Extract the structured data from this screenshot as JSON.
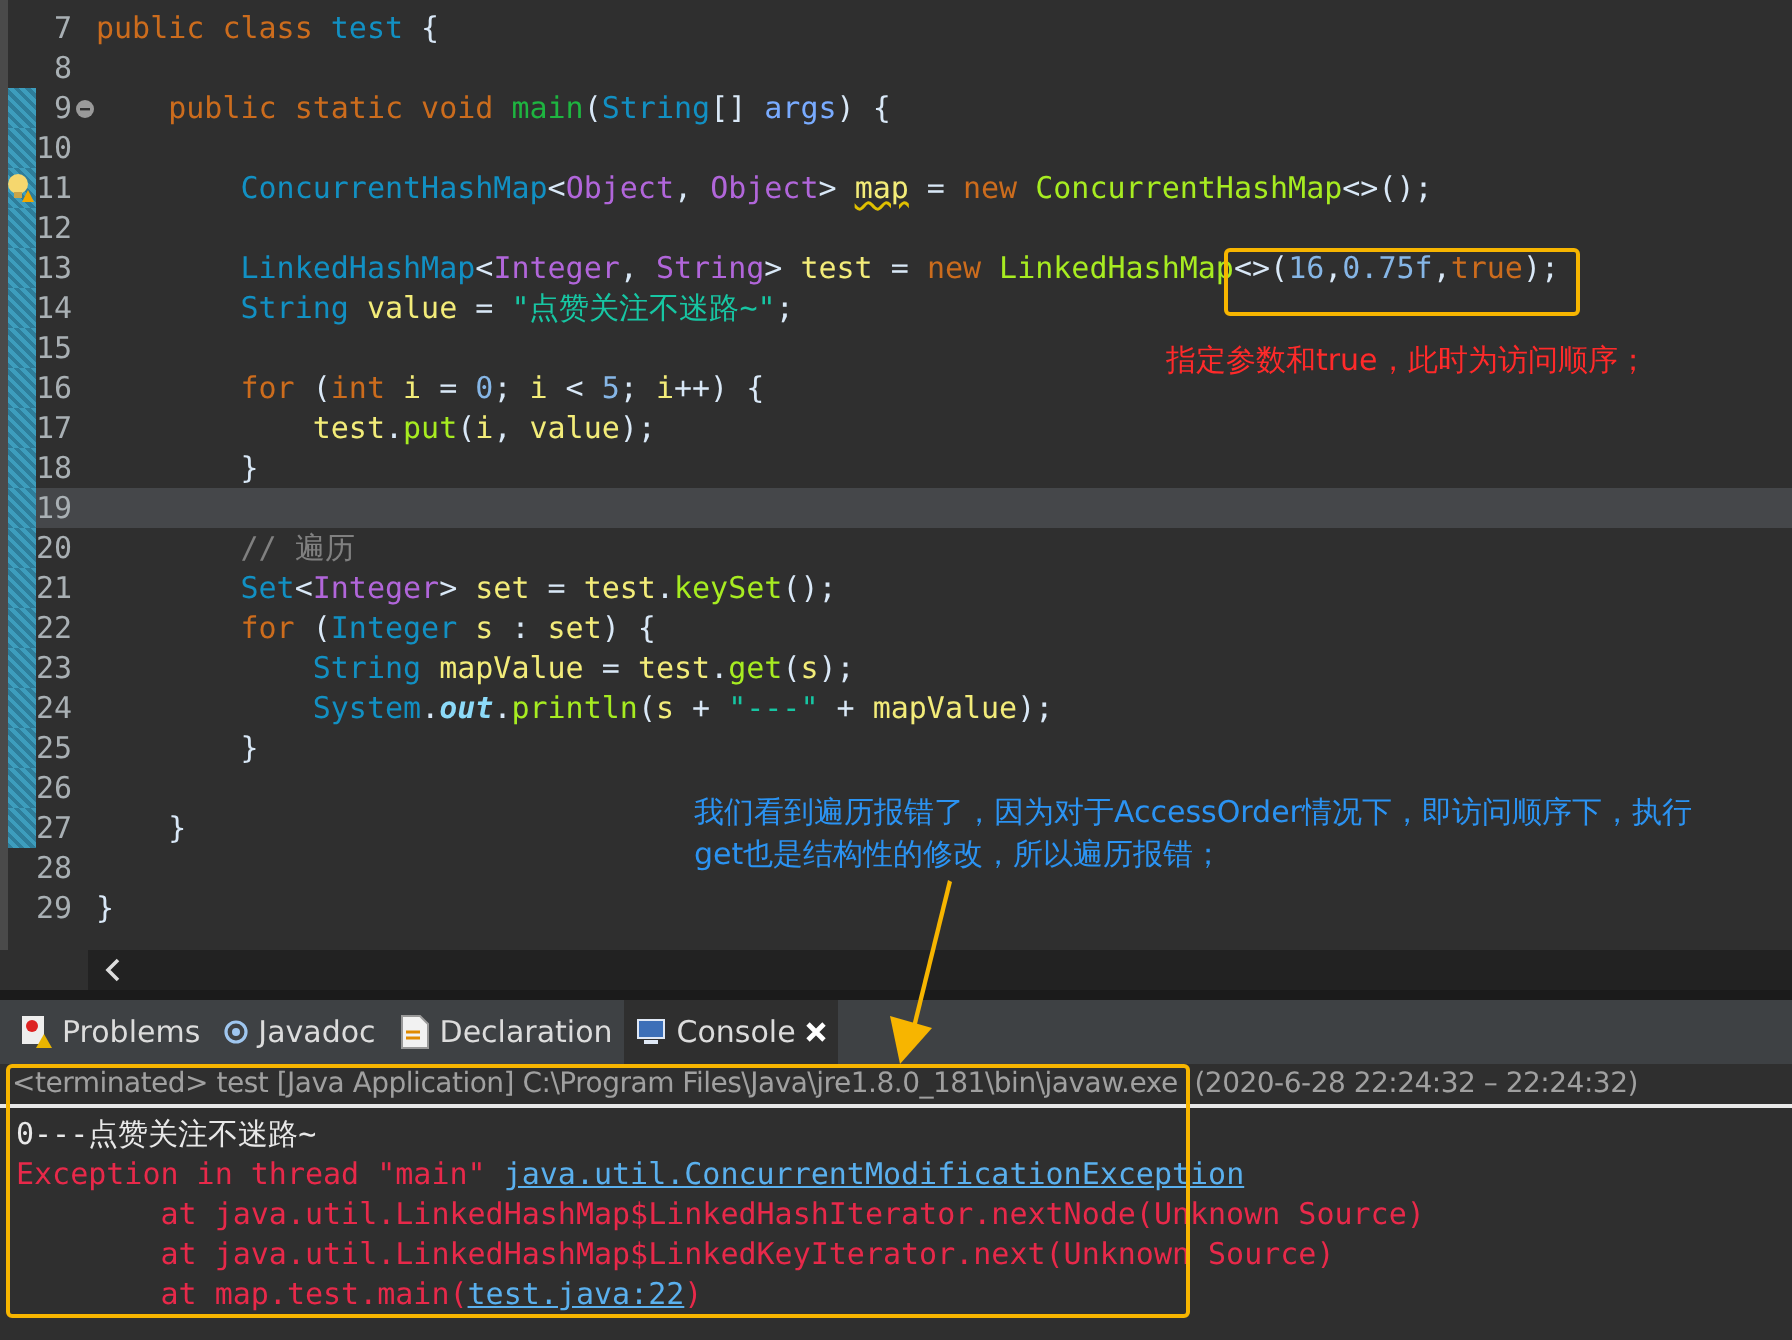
{
  "editor": {
    "lines": [
      {
        "number": "7",
        "changed": false,
        "current": false,
        "tokens": [
          {
            "text": "public class",
            "kind": "keyword"
          },
          {
            "text": " test",
            "kind": "type"
          },
          {
            "text": " {",
            "kind": "plain"
          }
        ]
      },
      {
        "number": "8",
        "changed": false,
        "current": false
      },
      {
        "number": "9",
        "changed": true,
        "current": false,
        "collapsible": true,
        "tokens": [
          {
            "text": "    public static void",
            "kind": "keyword"
          },
          {
            "text": " main",
            "kind": "method-decl"
          },
          {
            "text": "(",
            "kind": "plain"
          },
          {
            "text": "String",
            "kind": "type"
          },
          {
            "text": "[] ",
            "kind": "plain"
          },
          {
            "text": "args",
            "kind": "param"
          },
          {
            "text": ") {",
            "kind": "plain"
          }
        ]
      },
      {
        "number": "10",
        "changed": true,
        "current": false
      },
      {
        "number": "11",
        "changed": true,
        "current": false,
        "warning": true,
        "tokens": [
          {
            "text": "        ConcurrentHashMap",
            "kind": "type"
          },
          {
            "text": "<",
            "kind": "plain"
          },
          {
            "text": "Object",
            "kind": "type-param"
          },
          {
            "text": ", ",
            "kind": "plain"
          },
          {
            "text": "Object",
            "kind": "type-param"
          },
          {
            "text": "> ",
            "kind": "plain"
          },
          {
            "text": "map",
            "kind": "warn-var"
          },
          {
            "text": " = ",
            "kind": "plain"
          },
          {
            "text": "new",
            "kind": "keyword"
          },
          {
            "text": " ConcurrentHashMap",
            "kind": "method"
          },
          {
            "text": "<>();",
            "kind": "plain"
          }
        ]
      },
      {
        "number": "12",
        "changed": true,
        "current": false
      },
      {
        "number": "13",
        "changed": true,
        "current": false,
        "tokens": [
          {
            "text": "        LinkedHashMap",
            "kind": "type"
          },
          {
            "text": "<",
            "kind": "plain"
          },
          {
            "text": "Integer",
            "kind": "type-param"
          },
          {
            "text": ", ",
            "kind": "plain"
          },
          {
            "text": "String",
            "kind": "type-param"
          },
          {
            "text": "> ",
            "kind": "plain"
          },
          {
            "text": "test",
            "kind": "var"
          },
          {
            "text": " = ",
            "kind": "plain"
          },
          {
            "text": "new",
            "kind": "keyword"
          },
          {
            "text": " LinkedHashMap",
            "kind": "method"
          },
          {
            "text": "<>(",
            "kind": "plain"
          },
          {
            "text": "16",
            "kind": "number"
          },
          {
            "text": ",",
            "kind": "plain"
          },
          {
            "text": "0.75f",
            "kind": "number"
          },
          {
            "text": ",",
            "kind": "plain"
          },
          {
            "text": "true",
            "kind": "keyword"
          },
          {
            "text": ");",
            "kind": "plain"
          }
        ]
      },
      {
        "number": "14",
        "changed": true,
        "current": false,
        "tokens": [
          {
            "text": "        String",
            "kind": "type"
          },
          {
            "text": " value",
            "kind": "var"
          },
          {
            "text": " = ",
            "kind": "plain"
          },
          {
            "text": "\"点赞关注不迷路~\"",
            "kind": "string"
          },
          {
            "text": ";",
            "kind": "plain"
          }
        ]
      },
      {
        "number": "15",
        "changed": true,
        "current": false
      },
      {
        "number": "16",
        "changed": true,
        "current": false,
        "tokens": [
          {
            "text": "        for",
            "kind": "keyword"
          },
          {
            "text": " (",
            "kind": "plain"
          },
          {
            "text": "int",
            "kind": "keyword"
          },
          {
            "text": " i",
            "kind": "var"
          },
          {
            "text": " = ",
            "kind": "plain"
          },
          {
            "text": "0",
            "kind": "number"
          },
          {
            "text": "; ",
            "kind": "plain"
          },
          {
            "text": "i",
            "kind": "var"
          },
          {
            "text": " < ",
            "kind": "plain"
          },
          {
            "text": "5",
            "kind": "number"
          },
          {
            "text": "; ",
            "kind": "plain"
          },
          {
            "text": "i",
            "kind": "var"
          },
          {
            "text": "++) {",
            "kind": "plain"
          }
        ]
      },
      {
        "number": "17",
        "changed": true,
        "current": false,
        "tokens": [
          {
            "text": "            test",
            "kind": "var"
          },
          {
            "text": ".",
            "kind": "plain"
          },
          {
            "text": "put",
            "kind": "method"
          },
          {
            "text": "(",
            "kind": "plain"
          },
          {
            "text": "i",
            "kind": "var"
          },
          {
            "text": ", ",
            "kind": "plain"
          },
          {
            "text": "value",
            "kind": "var"
          },
          {
            "text": ");",
            "kind": "plain"
          }
        ]
      },
      {
        "number": "18",
        "changed": true,
        "current": false,
        "tokens": [
          {
            "text": "        }",
            "kind": "plain"
          }
        ]
      },
      {
        "number": "19",
        "changed": true,
        "current": true
      },
      {
        "number": "20",
        "changed": true,
        "current": false,
        "tokens": [
          {
            "text": "        // 遍历",
            "kind": "comment"
          }
        ]
      },
      {
        "number": "21",
        "changed": true,
        "current": false,
        "tokens": [
          {
            "text": "        Set",
            "kind": "type"
          },
          {
            "text": "<",
            "kind": "plain"
          },
          {
            "text": "Integer",
            "kind": "type-param"
          },
          {
            "text": "> ",
            "kind": "plain"
          },
          {
            "text": "set",
            "kind": "var"
          },
          {
            "text": " = ",
            "kind": "plain"
          },
          {
            "text": "test",
            "kind": "var"
          },
          {
            "text": ".",
            "kind": "plain"
          },
          {
            "text": "keySet",
            "kind": "method"
          },
          {
            "text": "();",
            "kind": "plain"
          }
        ]
      },
      {
        "number": "22",
        "changed": true,
        "current": false,
        "tokens": [
          {
            "text": "        for",
            "kind": "keyword"
          },
          {
            "text": " (",
            "kind": "plain"
          },
          {
            "text": "Integer",
            "kind": "type"
          },
          {
            "text": " s",
            "kind": "var"
          },
          {
            "text": " : ",
            "kind": "plain"
          },
          {
            "text": "set",
            "kind": "var"
          },
          {
            "text": ") {",
            "kind": "plain"
          }
        ]
      },
      {
        "number": "23",
        "changed": true,
        "current": false,
        "tokens": [
          {
            "text": "            String",
            "kind": "type"
          },
          {
            "text": " mapValue",
            "kind": "var"
          },
          {
            "text": " = ",
            "kind": "plain"
          },
          {
            "text": "test",
            "kind": "var"
          },
          {
            "text": ".",
            "kind": "plain"
          },
          {
            "text": "get",
            "kind": "method"
          },
          {
            "text": "(",
            "kind": "plain"
          },
          {
            "text": "s",
            "kind": "var"
          },
          {
            "text": ");",
            "kind": "plain"
          }
        ]
      },
      {
        "number": "24",
        "changed": true,
        "current": false,
        "tokens": [
          {
            "text": "            System",
            "kind": "type"
          },
          {
            "text": ".",
            "kind": "plain"
          },
          {
            "text": "out",
            "kind": "field"
          },
          {
            "text": ".",
            "kind": "plain"
          },
          {
            "text": "println",
            "kind": "method"
          },
          {
            "text": "(",
            "kind": "plain"
          },
          {
            "text": "s",
            "kind": "var"
          },
          {
            "text": " + ",
            "kind": "plain"
          },
          {
            "text": "\"---\"",
            "kind": "string"
          },
          {
            "text": " + ",
            "kind": "plain"
          },
          {
            "text": "mapValue",
            "kind": "var"
          },
          {
            "text": ");",
            "kind": "plain"
          }
        ]
      },
      {
        "number": "25",
        "changed": true,
        "current": false,
        "tokens": [
          {
            "text": "        }",
            "kind": "plain"
          }
        ]
      },
      {
        "number": "26",
        "changed": true,
        "current": false
      },
      {
        "number": "27",
        "changed": true,
        "current": false,
        "tokens": [
          {
            "text": "    }",
            "kind": "plain"
          }
        ]
      },
      {
        "number": "28",
        "changed": false,
        "current": false
      },
      {
        "number": "29",
        "changed": false,
        "current": false,
        "tokens": [
          {
            "text": "}",
            "kind": "plain"
          }
        ]
      }
    ]
  },
  "panel": {
    "tabs": [
      {
        "label": "Problems",
        "selected": false
      },
      {
        "label": "Javadoc",
        "selected": false
      },
      {
        "label": "Declaration",
        "selected": false
      },
      {
        "label": "Console",
        "selected": true
      }
    ],
    "console": {
      "header": "<terminated> test [Java Application] C:\\Program Files\\Java\\jre1.8.0_181\\bin\\javaw.exe  (2020-6-28 22:24:32 – 22:24:32)",
      "lines": [
        [
          {
            "text": "0---点赞关注不迷路~",
            "kind": "out"
          }
        ],
        [
          {
            "text": "Exception in thread \"main\" ",
            "kind": "err"
          },
          {
            "text": "java.util.ConcurrentModificationException",
            "kind": "link"
          }
        ],
        [
          {
            "text": "        at java.util.LinkedHashMap$LinkedHashIterator.nextNode(Unknown Source)",
            "kind": "err"
          }
        ],
        [
          {
            "text": "        at java.util.LinkedHashMap$LinkedKeyIterator.next(Unknown Source)",
            "kind": "err"
          }
        ],
        [
          {
            "text": "        at map.test.main(",
            "kind": "err"
          },
          {
            "text": "test.java:22",
            "kind": "link"
          },
          {
            "text": ")",
            "kind": "err"
          }
        ]
      ]
    }
  },
  "annotations": {
    "code_note": "指定参数和true，此时为访问顺序；",
    "console_note": "我们看到遍历报错了，因为对于AccessOrder情况下，即访问顺序下，执行get也是结构性的修改，所以遍历报错；"
  }
}
